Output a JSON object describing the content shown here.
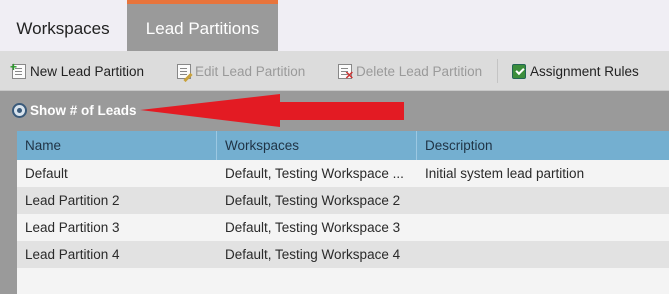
{
  "tabs": [
    {
      "label": "Workspaces"
    },
    {
      "label": "Lead Partitions"
    }
  ],
  "toolbar": {
    "new_label": "New Lead Partition",
    "edit_label": "Edit Lead Partition",
    "delete_label": "Delete Lead Partition",
    "assign_label": "Assignment Rules"
  },
  "show_leads_label": "Show # of Leads",
  "grid": {
    "columns": [
      "Name",
      "Workspaces",
      "Description"
    ],
    "rows": [
      {
        "name": "Default",
        "workspaces": "Default, Testing Workspace ...",
        "description": "Initial system lead partition"
      },
      {
        "name": "Lead Partition 2",
        "workspaces": "Default, Testing Workspace 2",
        "description": ""
      },
      {
        "name": "Lead Partition 3",
        "workspaces": "Default, Testing Workspace 3",
        "description": ""
      },
      {
        "name": "Lead Partition 4",
        "workspaces": "Default, Testing Workspace 4",
        "description": ""
      }
    ]
  },
  "colors": {
    "active_tab_accent": "#e8743b",
    "header_bg": "#74afd0",
    "annotation_arrow": "#e31b23"
  }
}
